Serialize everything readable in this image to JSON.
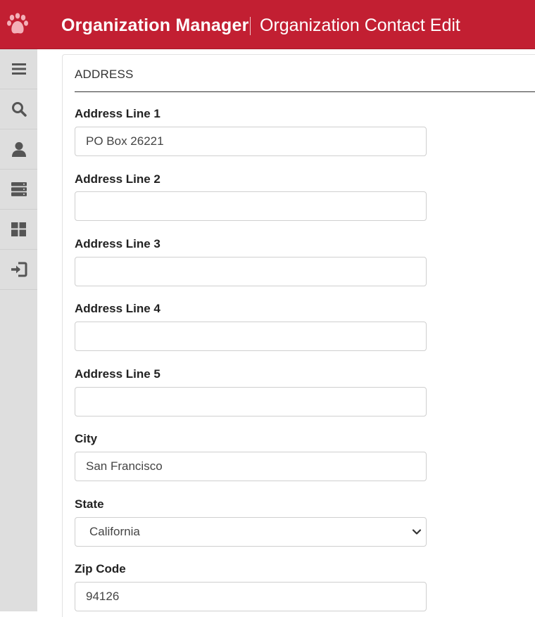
{
  "header": {
    "app_title": "Organization Manager",
    "page_title": "Organization Contact Edit",
    "background_color": "#c21f32",
    "logo_icon": "paw-icon"
  },
  "sidebar": {
    "background_color": "#dedede",
    "items": [
      {
        "icon": "menu-icon"
      },
      {
        "icon": "search-icon"
      },
      {
        "icon": "user-icon"
      },
      {
        "icon": "server-icon"
      },
      {
        "icon": "dashboard-icon"
      },
      {
        "icon": "sign-in-icon"
      }
    ]
  },
  "form": {
    "section_title": "ADDRESS",
    "address_line_1": {
      "label": "Address Line 1",
      "value": "PO Box 26221"
    },
    "address_line_2": {
      "label": "Address Line 2",
      "value": ""
    },
    "address_line_3": {
      "label": "Address Line 3",
      "value": ""
    },
    "address_line_4": {
      "label": "Address Line 4",
      "value": ""
    },
    "address_line_5": {
      "label": "Address Line 5",
      "value": ""
    },
    "city": {
      "label": "City",
      "value": "San Francisco"
    },
    "state": {
      "label": "State",
      "value": "California"
    },
    "zip": {
      "label": "Zip Code",
      "value": "94126"
    }
  }
}
